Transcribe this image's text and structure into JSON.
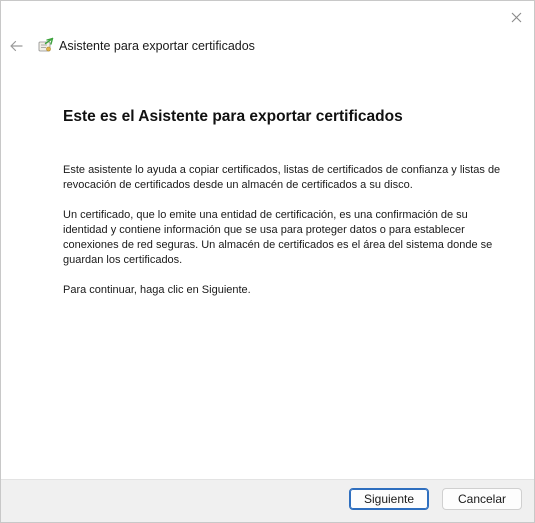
{
  "window": {
    "title": "Asistente para exportar certificados",
    "close_icon": "close-icon",
    "back_icon": "back-arrow-icon",
    "wizard_icon": "certificate-wizard-icon"
  },
  "content": {
    "heading": "Este es el Asistente para exportar certificados",
    "paragraphs": [
      "Este asistente lo ayuda a copiar certificados, listas de certificados de confianza y listas de revocación de certificados desde un almacén de certificados a su disco.",
      "Un certificado, que lo emite una entidad de certificación, es una confirmación de su identidad y contiene información que se usa para proteger datos o para establecer conexiones de red seguras. Un almacén de certificados es el área del sistema donde se guardan los certificados.",
      "Para continuar, haga clic en Siguiente."
    ]
  },
  "footer": {
    "next_label": "Siguiente",
    "cancel_label": "Cancelar"
  },
  "colors": {
    "primary_border": "#2f6fbf",
    "footer_bg": "#f0f0f0"
  }
}
